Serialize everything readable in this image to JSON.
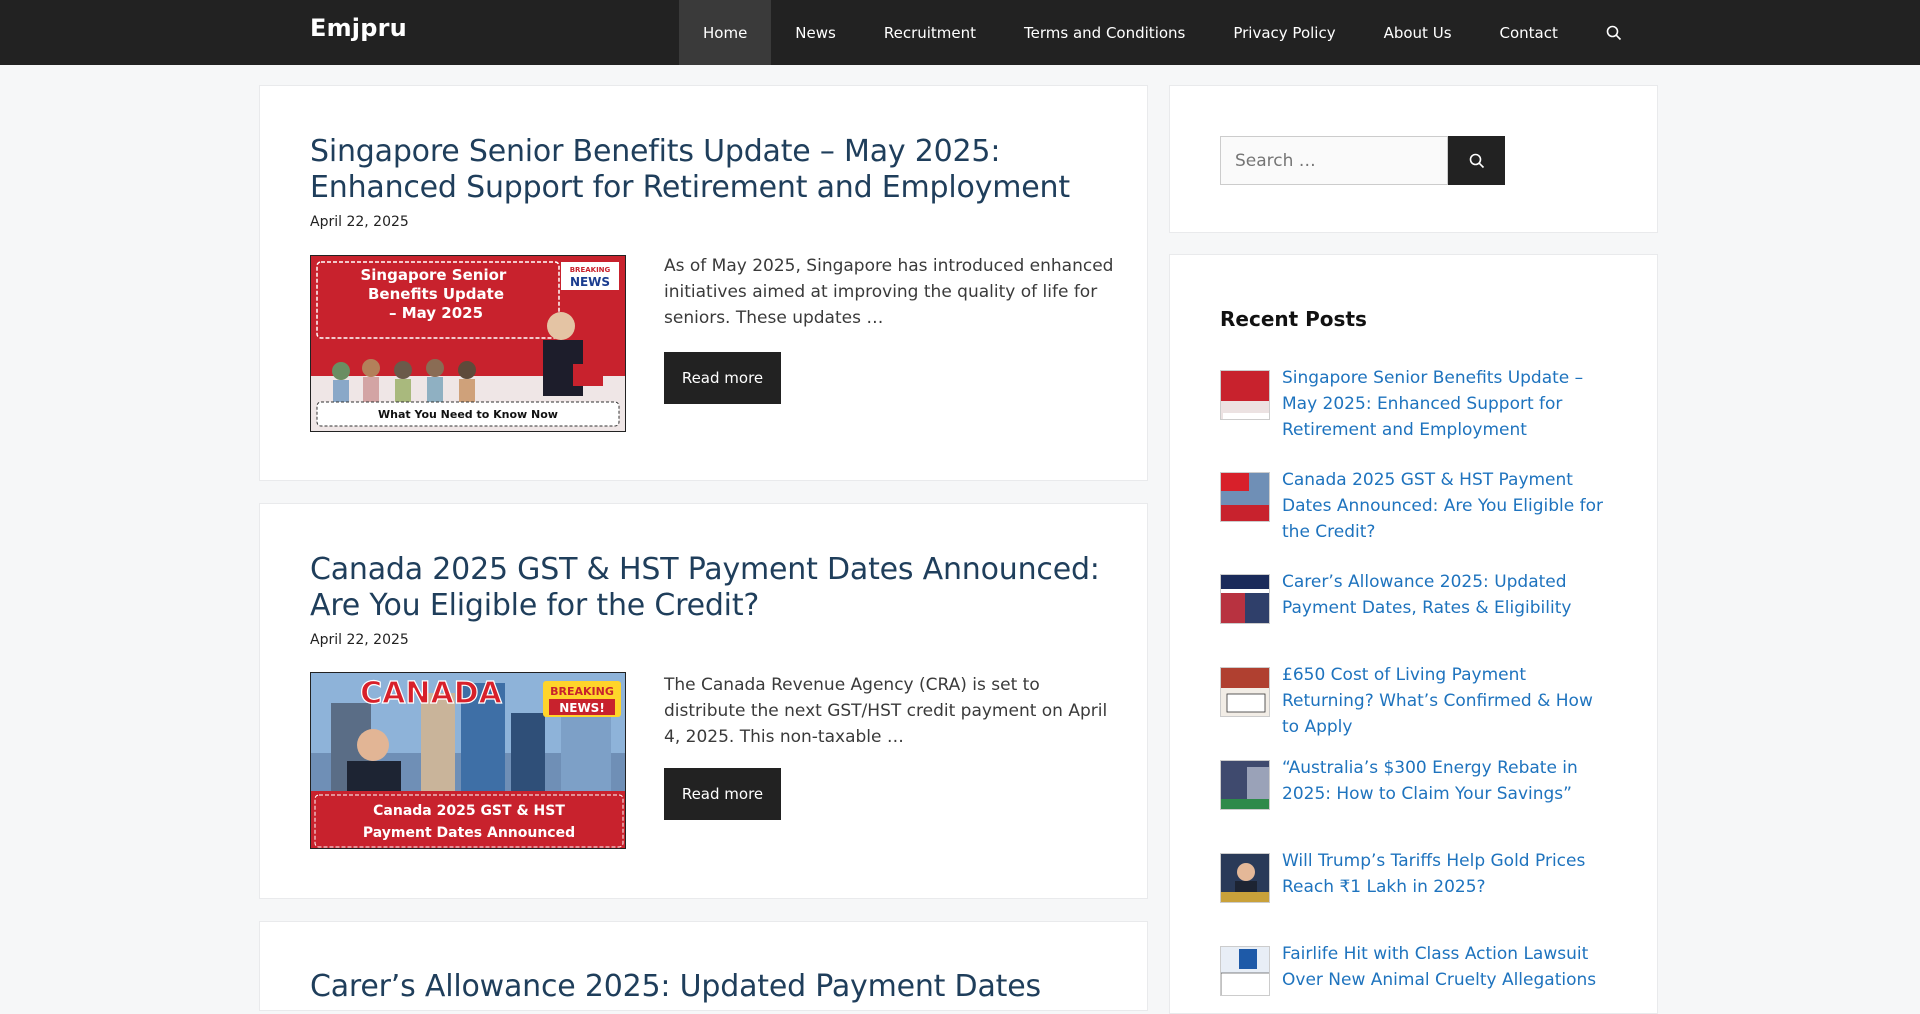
{
  "header": {
    "brand": "Emjpru",
    "nav": [
      "Home",
      "News",
      "Recruitment",
      "Terms and Conditions",
      "Privacy Policy",
      "About Us",
      "Contact"
    ]
  },
  "posts": [
    {
      "title": "Singapore Senior Benefits Update – May 2025: Enhanced Support for Retirement and Employment",
      "date": "April 22, 2025",
      "excerpt": "As of May 2025, Singapore has introduced enhanced initiatives aimed at improving the quality of life for seniors. These updates …",
      "read_more": "Read more",
      "image": {
        "headline": "Singapore Senior Benefits Update – May 2025",
        "badge_top": "BREAKING",
        "badge_bottom": "NEWS",
        "footer": "What You Need to Know Now"
      }
    },
    {
      "title": "Canada 2025 GST & HST Payment Dates Announced: Are You Eligible for the Credit?",
      "date": "April 22, 2025",
      "excerpt": "The Canada Revenue Agency (CRA) is set to distribute the next GST/HST credit payment on April 4, 2025. This non-taxable …",
      "read_more": "Read more",
      "image": {
        "headline": "CANADA",
        "badge_top": "BREAKING",
        "badge_bottom": "NEWS!",
        "footer": "Canada 2025 GST & HST Payment Dates Announced"
      }
    },
    {
      "title": "Carer’s Allowance 2025: Updated Payment Dates"
    }
  ],
  "sidebar": {
    "search_placeholder": "Search …",
    "recent_title": "Recent Posts",
    "recent": [
      "Singapore Senior Benefits Update – May 2025: Enhanced Support for Retirement and Employment",
      "Canada 2025 GST & HST Payment Dates Announced: Are You Eligible for the Credit?",
      "Carer’s Allowance 2025: Updated Payment Dates, Rates & Eligibility",
      "£650 Cost of Living Payment Returning? What’s Confirmed & How to Apply",
      "“Australia’s $300 Energy Rebate in 2025: How to Claim Your Savings”",
      "Will Trump’s Tariffs Help Gold Prices Reach ₹1 Lakh in 2025?",
      "Fairlife Hit with Class Action Lawsuit Over New Animal Cruelty Allegations"
    ]
  },
  "colors": {
    "topbar": "#222222",
    "title": "#1f3e5b",
    "link": "#1e73be",
    "button": "#222222"
  }
}
